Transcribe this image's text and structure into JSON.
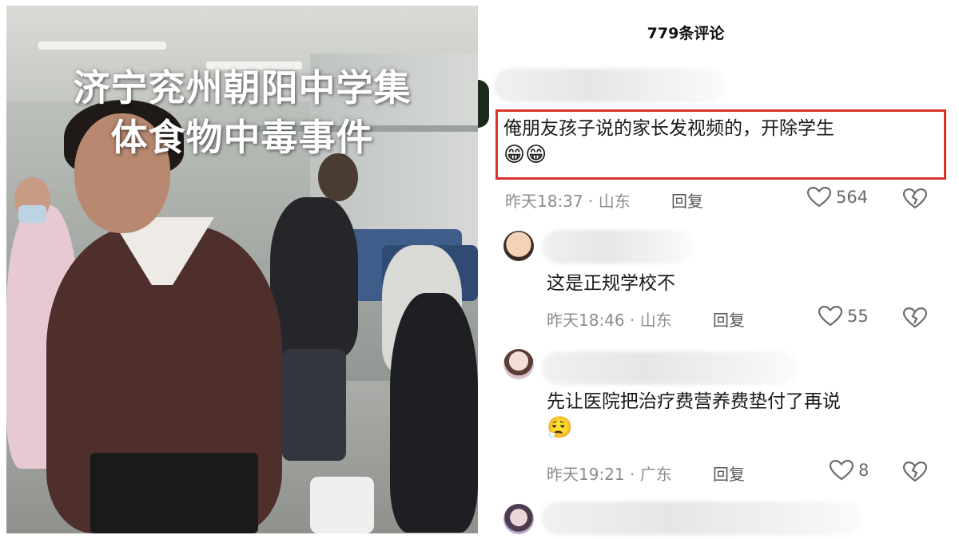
{
  "video": {
    "overlay_line1": "济宁兖州朝阳中学集",
    "overlay_line2": "体食物中毒事件"
  },
  "comments_header": {
    "title": "779条评论"
  },
  "comments": [
    {
      "text": "俺朋友孩子说的家长发视频的，开除学生",
      "emoji": "😁😁",
      "time_location": "昨天18:37 · 山东",
      "reply_label": "回复",
      "likes": "564",
      "highlighted": true
    },
    {
      "avatar_icon": "baby-avatar",
      "text": "这是正规学校不",
      "time_location": "昨天18:46 · 山东",
      "reply_label": "回复",
      "likes": "55"
    },
    {
      "avatar_icon": "girl-avatar",
      "text": "先让医院把治疗费营养费垫付了再说",
      "emoji": "😮‍💨",
      "time_location": "昨天19:21 · 广东",
      "reply_label": "回复",
      "likes": "8"
    },
    {
      "avatar_icon": "girl-avatar"
    }
  ],
  "colors": {
    "highlight_border": "#d9332b",
    "meta_text": "#8c8c8c"
  }
}
